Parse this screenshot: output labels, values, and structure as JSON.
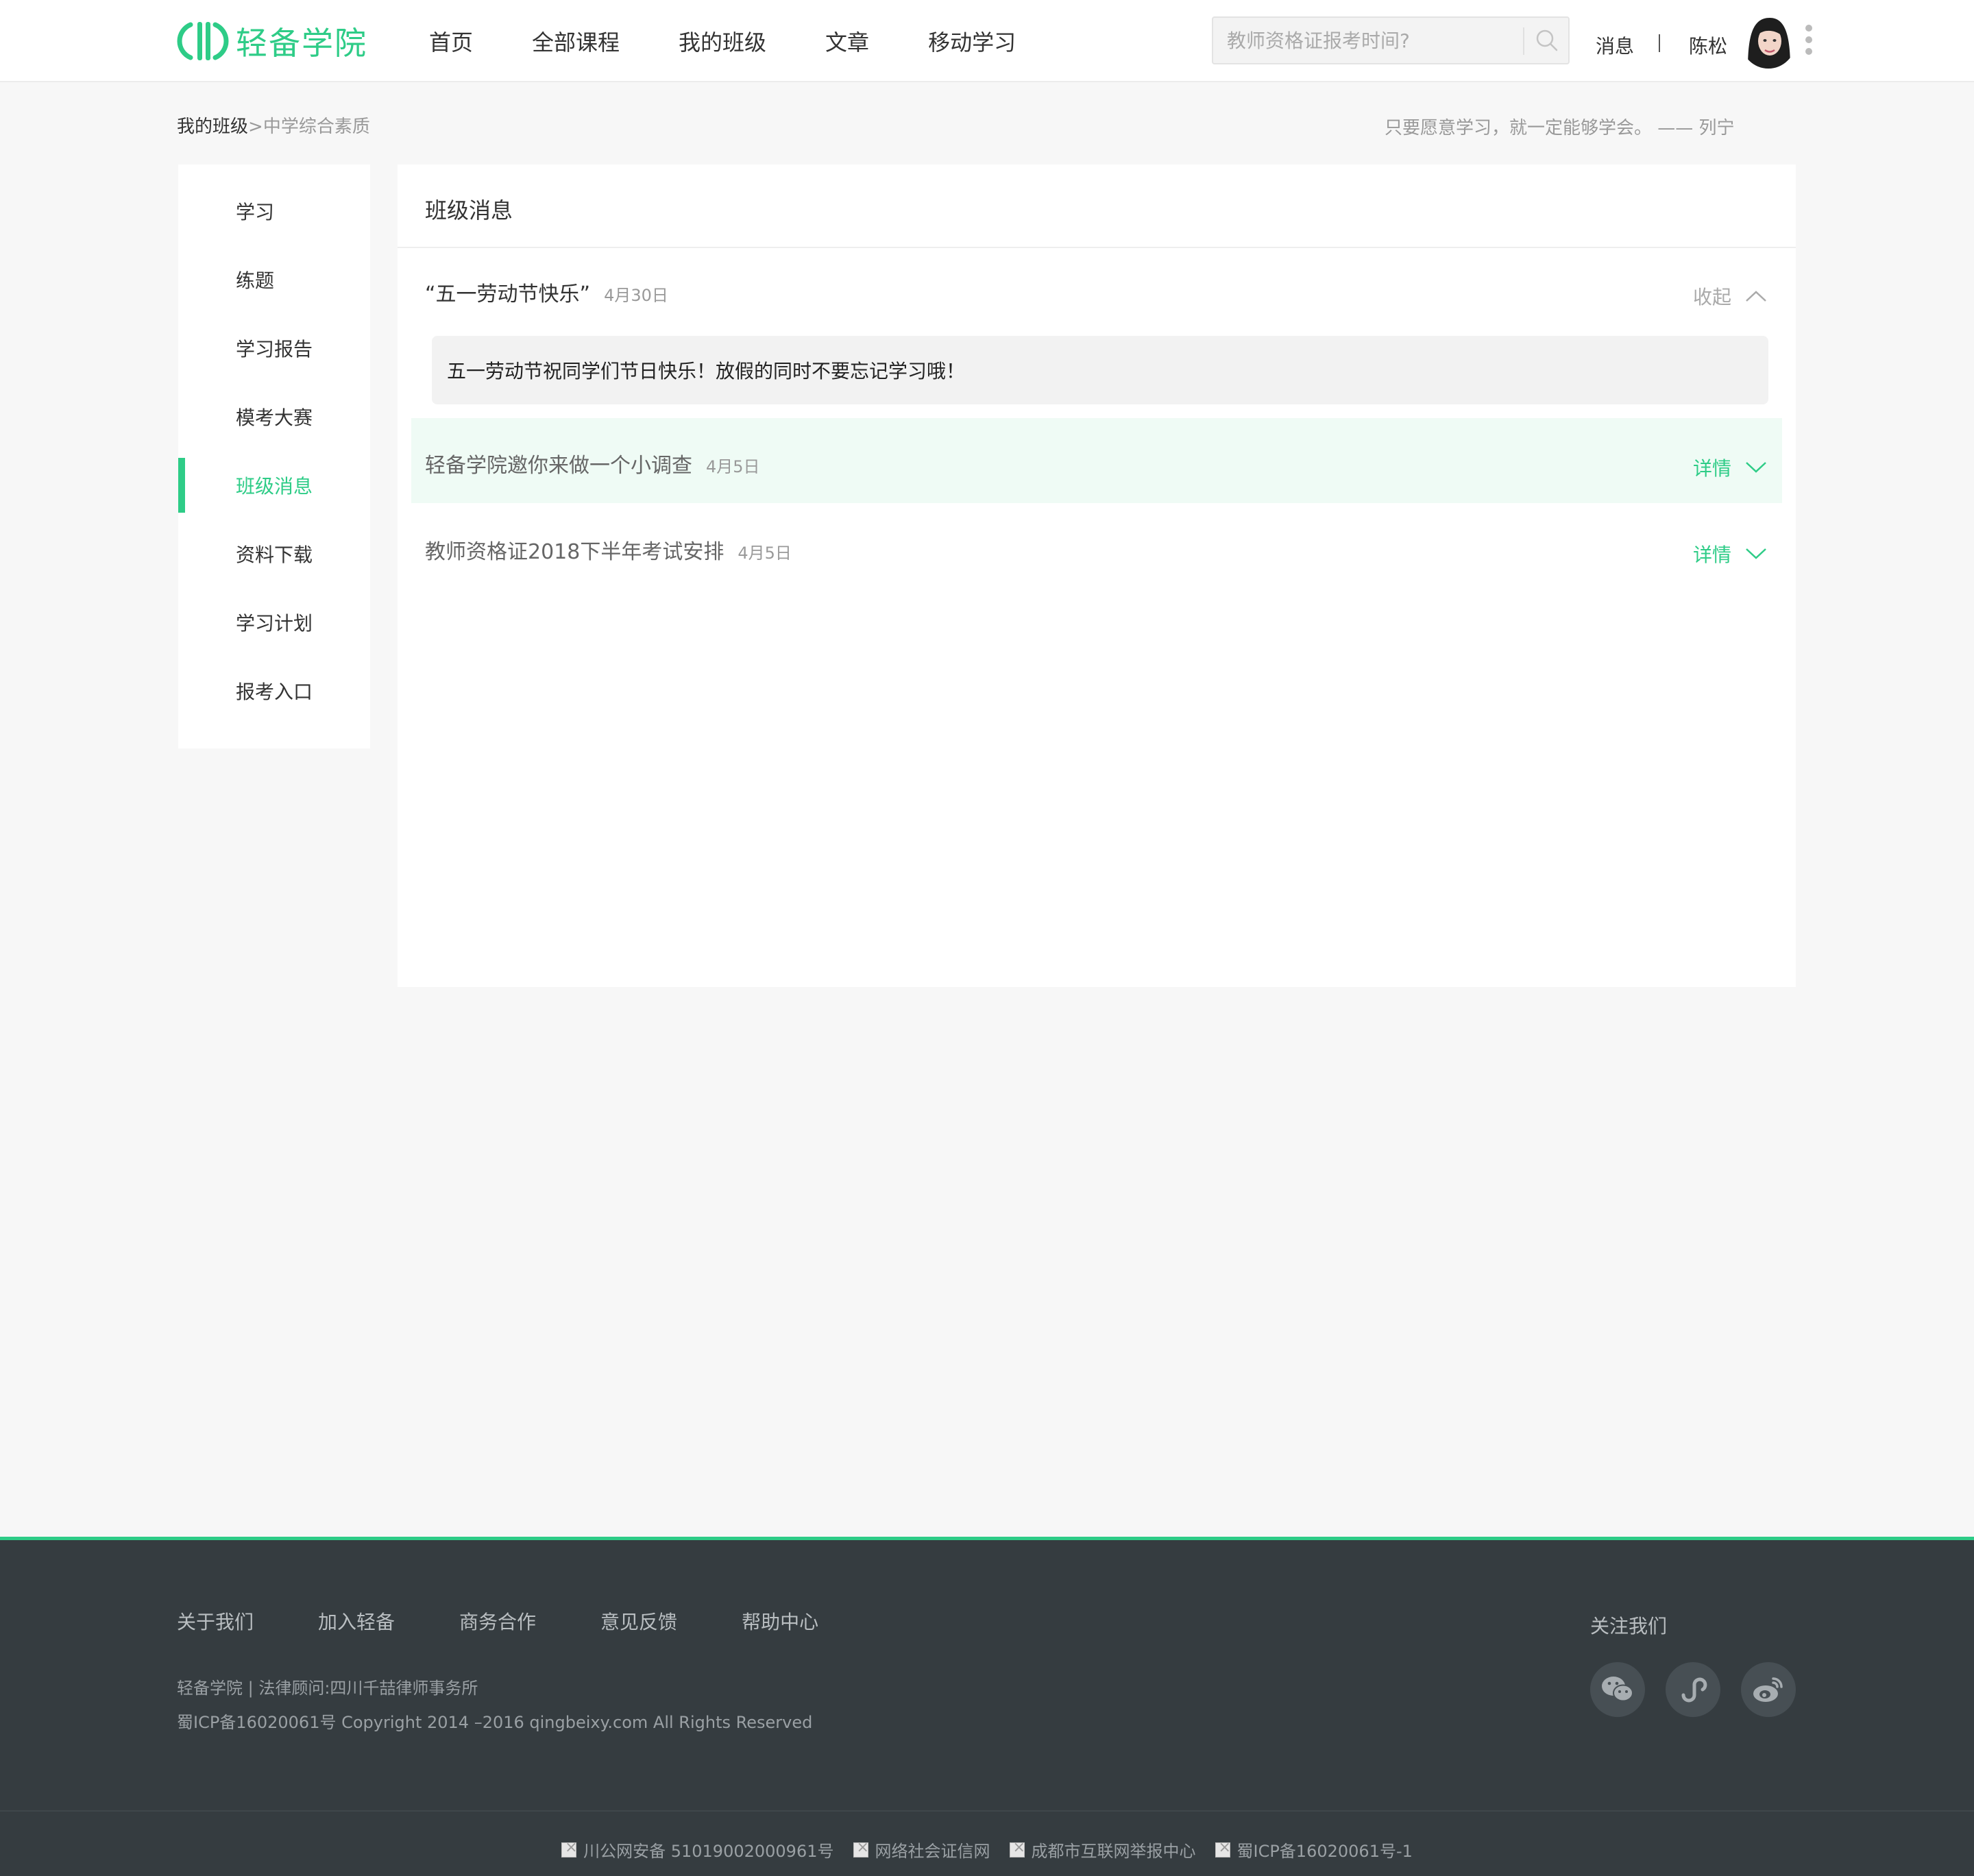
{
  "header": {
    "logo_text": "轻备学院",
    "nav": [
      "首页",
      "全部课程",
      "我的班级",
      "文章",
      "移动学习"
    ],
    "search_placeholder": "教师资格证报考时间?",
    "messages_label": "消息",
    "username": "陈松"
  },
  "breadcrumb": {
    "parent": "我的班级",
    "separator": ">",
    "current": "中学综合素质"
  },
  "quote": "只要愿意学习，就一定能够学会。 —— 列宁",
  "sidebar": {
    "items": [
      "学习",
      "练题",
      "学习报告",
      "模考大赛",
      "班级消息",
      "资料下载",
      "学习计划",
      "报考入口"
    ],
    "active_index": 4
  },
  "panel": {
    "title": "班级消息",
    "messages": [
      {
        "title": "“五一劳动节快乐”",
        "date": "4月30日",
        "toggle_label": "收起",
        "expanded": true,
        "body": "五一劳动节祝同学们节日快乐！放假的同时不要忘记学习哦！"
      },
      {
        "title": "轻备学院邀你来做一个小调查",
        "date": "4月5日",
        "toggle_label": "详情",
        "expanded": false
      },
      {
        "title": "教师资格证2018下半年考试安排",
        "date": "4月5日",
        "toggle_label": "详情",
        "expanded": false
      }
    ]
  },
  "footer": {
    "links": [
      "关于我们",
      "加入轻备",
      "商务合作",
      "意见反馈",
      "帮助中心"
    ],
    "info_line1": "轻备学院 | 法律顾问:四川千喆律师事务所",
    "info_line2": "蜀ICP备16020061号 Copyright 2014 –2016 qingbeixy.com All Rights Reserved",
    "follow_title": "关注我们",
    "social_icons": [
      "wechat-icon",
      "miniprogram-icon",
      "weibo-icon"
    ],
    "bottom_links": [
      "川公网安备 51019002000961号",
      "网络社会证信网",
      "成都市互联网举报中心",
      "蜀ICP备16020061号-1"
    ]
  },
  "colors": {
    "accent": "#2ecc87",
    "page_bg": "#f7f7f7",
    "footer_bg": "#353c40",
    "hover_row": "#effbf5"
  }
}
